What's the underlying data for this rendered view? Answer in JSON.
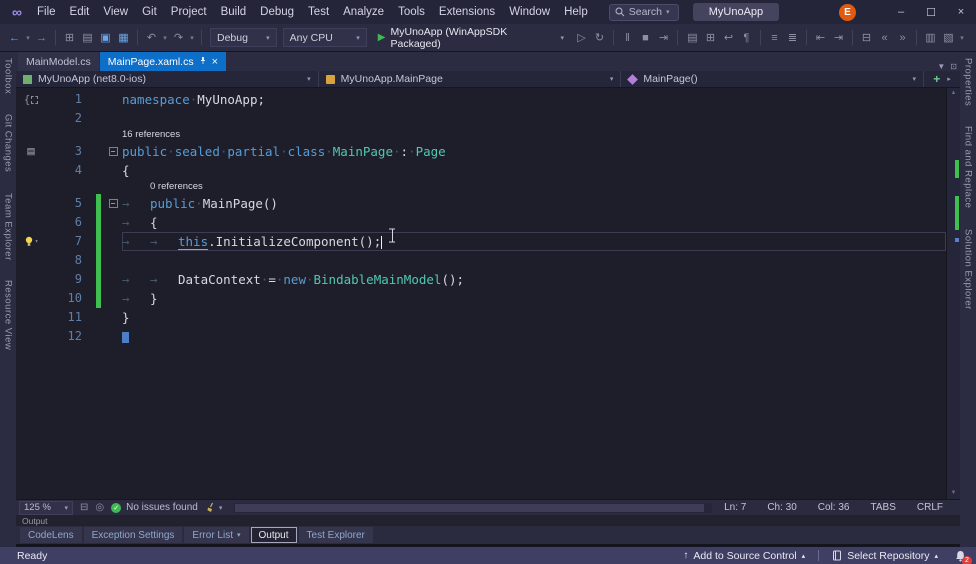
{
  "colors": {
    "accent": "#0e6fc8",
    "title_bg": "#25253a",
    "chrome_bg": "#2b2b41",
    "editor_bg": "#1e1e2b",
    "status_bg": "#3f3e63",
    "keyword": "#569cd6",
    "type_name": "#4ec9b0",
    "code_text": "#d8d8e2",
    "line_number": "#5f7fa6",
    "codelens": "#8f8f9e",
    "change_green": "#3fbf50",
    "run_green": "#3fba53",
    "error_red": "#e03e3e"
  },
  "title_bar": {
    "menus": [
      "File",
      "Edit",
      "View",
      "Git",
      "Project",
      "Build",
      "Debug",
      "Test",
      "Analyze",
      "Tools",
      "Extensions",
      "Window",
      "Help"
    ],
    "search_label": "Search",
    "solution_name": "MyUnoApp",
    "account_initial": "E"
  },
  "toolbar": {
    "left_icons": [
      {
        "name": "navigate-backward-button",
        "glyph": "←",
        "style": "blue"
      },
      {
        "name": "navigate-backward-dropdown",
        "glyph": "▾",
        "style": "small"
      },
      {
        "name": "navigate-forward-button",
        "glyph": "→"
      },
      {
        "sep": true
      },
      {
        "name": "new-project-button",
        "glyph": "⊞"
      },
      {
        "name": "open-file-button",
        "glyph": "▤"
      },
      {
        "name": "save-button",
        "glyph": "▣",
        "style": "blue"
      },
      {
        "name": "save-all-button",
        "glyph": "▦",
        "style": "blue"
      },
      {
        "sep": true
      },
      {
        "name": "undo-button",
        "glyph": "↶"
      },
      {
        "name": "undo-dropdown",
        "glyph": "▾",
        "style": "small"
      },
      {
        "name": "redo-button",
        "glyph": "↷"
      },
      {
        "name": "redo-dropdown",
        "glyph": "▾",
        "style": "small"
      },
      {
        "sep": true
      }
    ],
    "config_label": "Debug",
    "platform_label": "Any CPU",
    "run_label": "MyUnoApp (WinAppSDK Packaged)",
    "mid_icons": [
      {
        "name": "start-without-debugging-button",
        "glyph": "▷"
      },
      {
        "name": "hot-reload-button",
        "glyph": "↻"
      },
      {
        "sep": true
      },
      {
        "name": "break-all-button",
        "glyph": "‖"
      },
      {
        "name": "stop-button",
        "glyph": "■"
      },
      {
        "name": "step-over-button",
        "glyph": "⇥"
      },
      {
        "sep": true
      }
    ],
    "right_icons": [
      {
        "name": "feedback-button",
        "glyph": "▤"
      },
      {
        "name": "compare-files-button",
        "glyph": "⊞"
      },
      {
        "name": "word-wrap-button",
        "glyph": "↩"
      },
      {
        "name": "show-whitespace-button",
        "glyph": "¶"
      },
      {
        "sep": true
      },
      {
        "name": "comment-button",
        "glyph": "≡"
      },
      {
        "name": "uncomment-button",
        "glyph": "≣"
      },
      {
        "sep": true
      },
      {
        "name": "decrease-indent-button",
        "glyph": "⇤"
      },
      {
        "name": "increase-indent-button",
        "glyph": "⇥"
      },
      {
        "sep": true
      },
      {
        "name": "bookmark-button",
        "glyph": "⊟"
      },
      {
        "name": "previous-bookmark-button",
        "glyph": "«"
      },
      {
        "name": "next-bookmark-button",
        "glyph": "»"
      },
      {
        "sep": true
      },
      {
        "name": "call-hierarchy-button",
        "glyph": "▥"
      },
      {
        "name": "code-map-button",
        "glyph": "▧"
      },
      {
        "name": "toolbar-overflow-button",
        "glyph": "▾",
        "style": "small"
      }
    ]
  },
  "document_tabs": [
    {
      "label": "MainModel.cs",
      "active": false
    },
    {
      "label": "MainPage.xaml.cs",
      "active": true
    }
  ],
  "left_strip": [
    "Toolbox",
    "Git Changes",
    "Team Explorer",
    "Resource View"
  ],
  "right_strip": [
    "Properties",
    "Find and Replace",
    "Solution Explorer"
  ],
  "breadcrumb": {
    "project": "MyUnoApp (net8.0-ios)",
    "type": "MyUnoApp.MainPage",
    "member": "MainPage()"
  },
  "editor": {
    "lines": [
      {
        "num": "1",
        "icon": "brace",
        "tokens": [
          [
            "kw",
            "namespace"
          ],
          [
            "ws",
            "·"
          ],
          [
            "id",
            "MyUnoApp"
          ],
          [
            "pn",
            ";"
          ]
        ]
      },
      {
        "num": "2",
        "tokens": []
      },
      {
        "num": "3",
        "icon": "inherit",
        "codelens": "16 references",
        "cl_indent": 0,
        "fold": true,
        "tokens": [
          [
            "kw",
            "public"
          ],
          [
            "ws",
            "·"
          ],
          [
            "kw",
            "sealed"
          ],
          [
            "ws",
            "·"
          ],
          [
            "kw",
            "partial"
          ],
          [
            "ws",
            "·"
          ],
          [
            "kw",
            "class"
          ],
          [
            "ws",
            "·"
          ],
          [
            "ty",
            "MainPage"
          ],
          [
            "ws",
            "·"
          ],
          [
            "pn",
            ":"
          ],
          [
            "ws",
            "·"
          ],
          [
            "ty",
            "Page"
          ]
        ]
      },
      {
        "num": "4",
        "tokens": [
          [
            "pn",
            "{"
          ]
        ]
      },
      {
        "num": "5",
        "codelens": "0 references",
        "cl_indent": 1,
        "fold": true,
        "changed": true,
        "tokens": [
          [
            "tab",
            "→"
          ],
          [
            "kw",
            "public"
          ],
          [
            "ws",
            "·"
          ],
          [
            "id",
            "MainPage"
          ],
          [
            "pn",
            "()"
          ]
        ]
      },
      {
        "num": "6",
        "changed": true,
        "tokens": [
          [
            "tab",
            "→"
          ],
          [
            "pn",
            "{"
          ]
        ]
      },
      {
        "num": "7",
        "changed": true,
        "current": true,
        "icon": "bulb",
        "tokens": [
          [
            "tab",
            "→"
          ],
          [
            "tab",
            "→"
          ],
          [
            "kwu",
            "this"
          ],
          [
            "pn",
            "."
          ],
          [
            "id",
            "InitializeComponent"
          ],
          [
            "pn",
            "();"
          ],
          [
            "caret",
            ""
          ]
        ]
      },
      {
        "num": "8",
        "changed": true,
        "tokens": []
      },
      {
        "num": "9",
        "changed": true,
        "tokens": [
          [
            "tab",
            "→"
          ],
          [
            "tab",
            "→"
          ],
          [
            "id",
            "DataContext"
          ],
          [
            "ws",
            "·"
          ],
          [
            "pn",
            "="
          ],
          [
            "ws",
            "·"
          ],
          [
            "kw",
            "new"
          ],
          [
            "ws",
            "·"
          ],
          [
            "ty",
            "BindableMainModel"
          ],
          [
            "pn",
            "();"
          ]
        ]
      },
      {
        "num": "10",
        "changed": true,
        "tokens": [
          [
            "tab",
            "→"
          ],
          [
            "pn",
            "}"
          ]
        ]
      },
      {
        "num": "11",
        "tokens": [
          [
            "pn",
            "}"
          ]
        ]
      },
      {
        "num": "12",
        "tokens": [
          [
            "box",
            ""
          ]
        ]
      }
    ]
  },
  "editor_status": {
    "zoom": "125 %",
    "health": "No issues found",
    "line": "Ln: 7",
    "column_char": "Ch: 30",
    "column": "Col: 36",
    "tabs": "TABS",
    "line_ending": "CRLF"
  },
  "bottom_panel": {
    "header": "Output",
    "tabs": [
      {
        "label": "CodeLens"
      },
      {
        "label": "Exception Settings"
      },
      {
        "label": "Error List",
        "dropdown": true
      },
      {
        "label": "Output",
        "active": true
      },
      {
        "label": "Test Explorer"
      }
    ]
  },
  "status_bar": {
    "ready": "Ready",
    "add_to_source_control": "Add to Source Control",
    "select_repository": "Select Repository",
    "notification_count": "2"
  }
}
